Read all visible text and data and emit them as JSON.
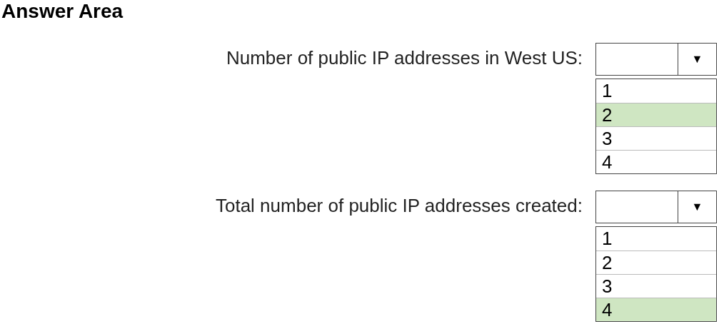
{
  "title": "Answer Area",
  "questions": [
    {
      "label": "Number of public IP addresses in West US:",
      "arrow": "▼",
      "options": [
        {
          "text": "1",
          "selected": false
        },
        {
          "text": "2",
          "selected": true
        },
        {
          "text": "3",
          "selected": false
        },
        {
          "text": "4",
          "selected": false
        }
      ]
    },
    {
      "label": "Total number of public IP addresses created:",
      "arrow": "▼",
      "options": [
        {
          "text": "1",
          "selected": false
        },
        {
          "text": "2",
          "selected": false
        },
        {
          "text": "3",
          "selected": false
        },
        {
          "text": "4",
          "selected": true
        }
      ]
    }
  ]
}
